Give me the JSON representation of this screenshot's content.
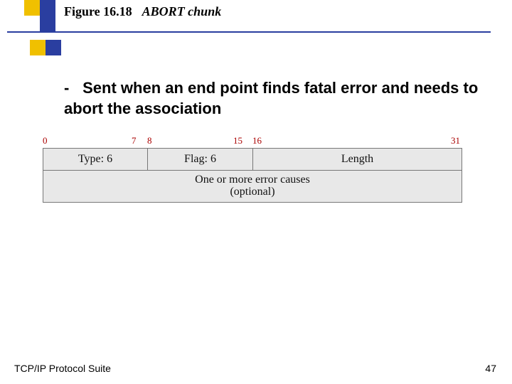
{
  "header": {
    "figure_label": "Figure 16.18",
    "figure_caption": "ABORT chunk"
  },
  "bullet": {
    "dash": "-",
    "text": "Sent when an end point finds fatal error and needs to abort the association"
  },
  "packet": {
    "bits": {
      "b0": "0",
      "b7": "7",
      "b8": "8",
      "b15": "15",
      "b16": "16",
      "b31": "31"
    },
    "row1": {
      "type": "Type: 6",
      "flag": "Flag: 6",
      "length": "Length"
    },
    "row2": {
      "line1": "One or more error causes",
      "line2": "(optional)"
    }
  },
  "footer": {
    "left": "TCP/IP Protocol Suite",
    "right": "47"
  }
}
